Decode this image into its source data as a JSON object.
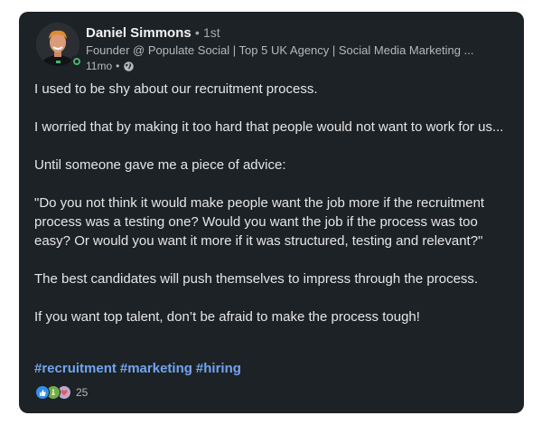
{
  "post": {
    "author": {
      "name": "Daniel Simmons",
      "separator": "•",
      "degree": "1st",
      "headline": "Founder @ Populate Social | Top 5 UK Agency | Social Media Marketing ...",
      "time": "11mo",
      "meta_separator": "•",
      "visibility_icon": "globe-icon",
      "online_status": "online"
    },
    "paragraphs": [
      "I used to be shy about our recruitment process.",
      "I worried that by making it too hard that people would not want to work for us...",
      "Until someone gave me a piece of advice:",
      "\"Do you not think it would make people want the job more if the recruitment process was a testing one? Would you want the job if the process was too easy? Or would you want it more if it was structured, testing and relevant?\"",
      "The best candidates will push themselves to impress through the process.",
      "If you want top talent, don’t be afraid to make the process tough!"
    ],
    "hashtags": [
      "#recruitment",
      "#marketing",
      "#hiring"
    ],
    "reactions": {
      "icons": [
        "like-reaction-icon",
        "celebrate-reaction-icon",
        "support-reaction-icon"
      ],
      "count": "25"
    }
  },
  "colors": {
    "card_background": "#1d2226",
    "hashtag": "#70a5f0",
    "online": "#49b56a",
    "like": "#378fe9",
    "celebrate": "#6dae4f",
    "support": "#bba9d1"
  }
}
